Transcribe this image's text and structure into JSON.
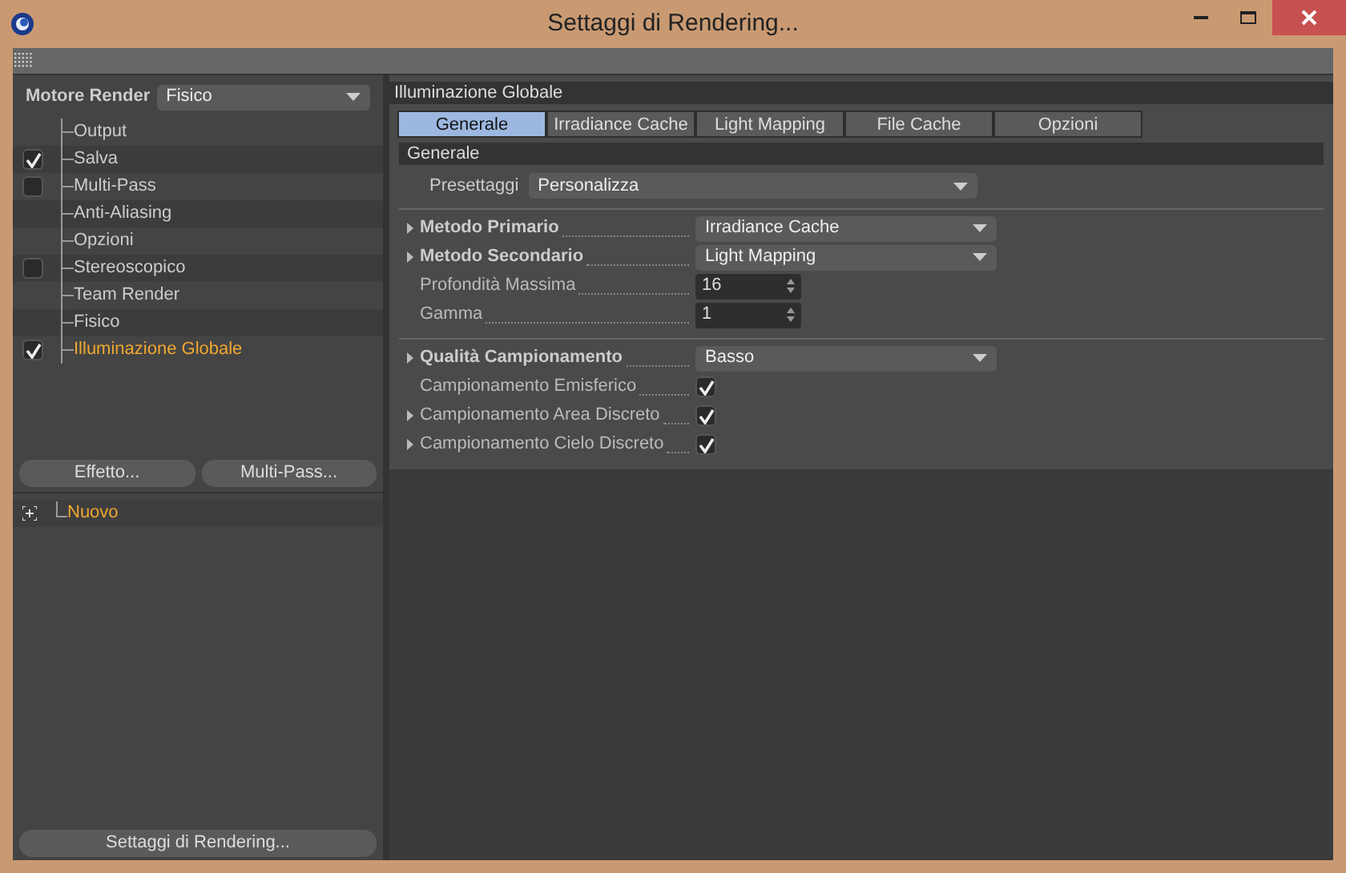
{
  "window": {
    "title": "Settaggi di Rendering..."
  },
  "render_engine": {
    "label": "Motore Render",
    "value": "Fisico"
  },
  "sidebar": {
    "items": [
      {
        "label": "Output",
        "kind": "plain",
        "selected": false
      },
      {
        "label": "Salva",
        "kind": "checkbox",
        "checked": true,
        "selected": false
      },
      {
        "label": "Multi-Pass",
        "kind": "checkbox",
        "checked": false,
        "selected": false
      },
      {
        "label": "Anti-Aliasing",
        "kind": "plain",
        "selected": false
      },
      {
        "label": "Opzioni",
        "kind": "plain",
        "selected": false
      },
      {
        "label": "Stereoscopico",
        "kind": "checkbox",
        "checked": false,
        "selected": false
      },
      {
        "label": "Team Render",
        "kind": "plain",
        "selected": false
      },
      {
        "label": "Fisico",
        "kind": "plain",
        "selected": false
      },
      {
        "label": "Illuminazione Globale",
        "kind": "checkbox",
        "checked": true,
        "selected": true
      }
    ]
  },
  "sidebar_buttons": [
    "Effetto...",
    "Multi-Pass..."
  ],
  "presets": {
    "items": [
      {
        "label": "Nuovo",
        "selected": true
      }
    ]
  },
  "footer_button": "Settaggi di Rendering...",
  "panel": {
    "title": "Illuminazione Globale",
    "tabs": [
      {
        "label": "Generale",
        "selected": true
      },
      {
        "label": "Irradiance Cache",
        "selected": false
      },
      {
        "label": "Light Mapping",
        "selected": false
      },
      {
        "label": "File Cache",
        "selected": false
      },
      {
        "label": "Opzioni",
        "selected": false
      }
    ],
    "section": "Generale",
    "preset": {
      "label": "Presettaggi",
      "value": "Personalizza"
    },
    "groups": [
      [
        {
          "label": "Metodo Primario",
          "kind": "dropdown",
          "value": "Irradiance Cache",
          "expandable": true,
          "emphasized": true
        },
        {
          "label": "Metodo Secondario",
          "kind": "dropdown",
          "value": "Light Mapping",
          "expandable": true,
          "emphasized": true
        },
        {
          "label": "Profondità Massima",
          "kind": "spinner",
          "value": "16",
          "expandable": false,
          "emphasized": false
        },
        {
          "label": "Gamma",
          "kind": "spinner",
          "value": "1",
          "expandable": false,
          "emphasized": false
        }
      ],
      [
        {
          "label": "Qualità Campionamento",
          "kind": "dropdown",
          "value": "Basso",
          "expandable": true,
          "emphasized": true
        },
        {
          "label": "Campionamento Emisferico",
          "kind": "checkbox",
          "checked": true,
          "expandable": false,
          "emphasized": false
        },
        {
          "label": "Campionamento Area Discreto",
          "kind": "checkbox",
          "checked": true,
          "expandable": true,
          "emphasized": false
        },
        {
          "label": "Campionamento Cielo Discreto",
          "kind": "checkbox",
          "checked": true,
          "expandable": true,
          "emphasized": false
        }
      ]
    ]
  }
}
